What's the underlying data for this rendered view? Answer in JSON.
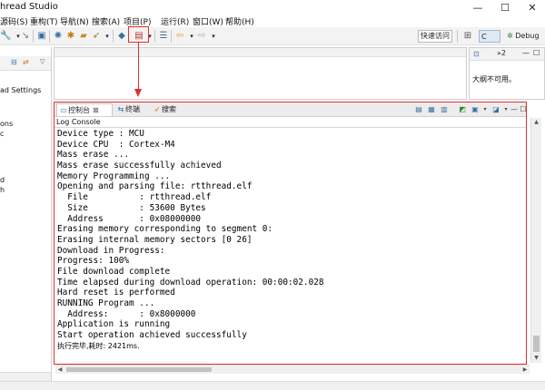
{
  "window": {
    "title": "hread Studio",
    "controls": {
      "minimize": "—",
      "maximize": "☐",
      "close": "✕"
    }
  },
  "menubar": {
    "items": [
      "源码(S)",
      "重构(T)",
      "导航(N)",
      "搜索(A)",
      "项目(P)",
      "运行(R)",
      "窗口(W)",
      "帮助(H)"
    ]
  },
  "toolbar": {
    "quick_access": "快速访问",
    "perspectives": {
      "c": "C",
      "debug": "Debug"
    },
    "icons": [
      "wrench-icon",
      "link-icon",
      "save-icon",
      "gear-icon",
      "bug-icon",
      "folder-icon",
      "rocket-icon",
      "download-icon",
      "terminal-icon",
      "back-arrow-icon",
      "forward-arrow-icon",
      "perspective-icon"
    ]
  },
  "left_panel": {
    "items": [
      "ad Settings",
      "ons",
      "c",
      "d",
      "h"
    ]
  },
  "outline_panel": {
    "tab_counter": "»2",
    "message": "大纲不可用。"
  },
  "console": {
    "tabs": [
      {
        "label": "控制台",
        "icon": "console-icon",
        "active": true
      },
      {
        "label": "终端",
        "icon": "terminal-icon",
        "active": false
      },
      {
        "label": "搜索",
        "icon": "search-icon",
        "active": false
      }
    ],
    "label": "Log Console",
    "lines": [
      "Device type : MCU",
      "Device CPU  : Cortex-M4",
      "Mass erase ...",
      "Mass erase successfully achieved",
      "Memory Programming ...",
      "Opening and parsing file: rtthread.elf",
      "  File          : rtthread.elf",
      "  Size          : 53600 Bytes",
      "  Address       : 0x08000000",
      "Erasing memory corresponding to segment 0:",
      "Erasing internal memory sectors [0 26]",
      "Download in Progress:",
      "Progress: 100%",
      "File download complete",
      "Time elapsed during download operation: 00:00:02.028",
      "Hard reset is performed",
      "RUNNING Program ...",
      "  Address:      : 0x8000000",
      "Application is running",
      "Start operation achieved successfully"
    ],
    "final_line": "执行完毕,耗时: 2421ms."
  },
  "colors": {
    "annotation": "#e03030",
    "accent": "#3a6ea5"
  }
}
